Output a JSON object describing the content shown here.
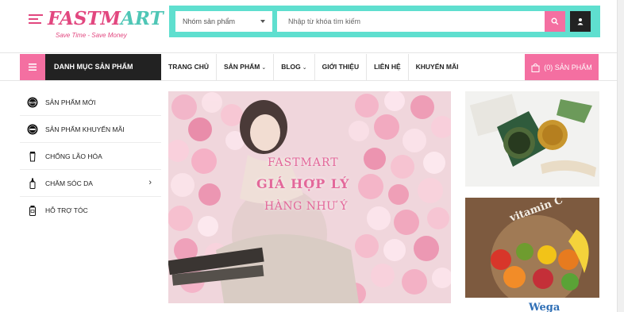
{
  "logo": {
    "word_main": "FASTM",
    "word_accent": "ART",
    "tagline": "Save Time - Save Money"
  },
  "search": {
    "category_label": "Nhóm sản phẩm",
    "placeholder": "Nhập từ khóa tìm kiếm",
    "button_icon": "search-icon",
    "account_icon": "user-icon"
  },
  "nav": {
    "categories_title": "DANH MỤC SẢN PHẨM",
    "items": [
      {
        "label": "TRANG CHỦ",
        "has_dropdown": false
      },
      {
        "label": "SẢN PHẨM",
        "has_dropdown": true
      },
      {
        "label": "BLOG",
        "has_dropdown": true
      },
      {
        "label": "GIỚI THIỆU",
        "has_dropdown": false
      },
      {
        "label": "LIÊN HỆ",
        "has_dropdown": false
      },
      {
        "label": "KHUYẾN MÃI",
        "has_dropdown": false
      }
    ],
    "cart_label": "(0) SẢN PHẨM"
  },
  "sidebar": {
    "items": [
      {
        "label": "SẢN PHẨM MỚI",
        "icon": "new-badge-icon"
      },
      {
        "label": "SẢN PHẨM KHUYẾN MÃI",
        "icon": "sale-badge-icon"
      },
      {
        "label": "CHỐNG LÃO HÓA",
        "icon": "tube-icon"
      },
      {
        "label": "CHĂM SÓC DA",
        "icon": "bottle-icon",
        "has_submenu": true
      },
      {
        "label": "HỖ TRỢ TÓC",
        "icon": "jar-icon"
      }
    ]
  },
  "banner": {
    "line1": "FASTMART",
    "line2": "GIÁ HỢP LÝ",
    "line3": "HÀNG NHƯ Ý"
  },
  "promo_3_text": "Wega",
  "colors": {
    "brand_pink": "#f46fa1",
    "brand_teal": "#5fdfcf",
    "dark": "#222222"
  }
}
